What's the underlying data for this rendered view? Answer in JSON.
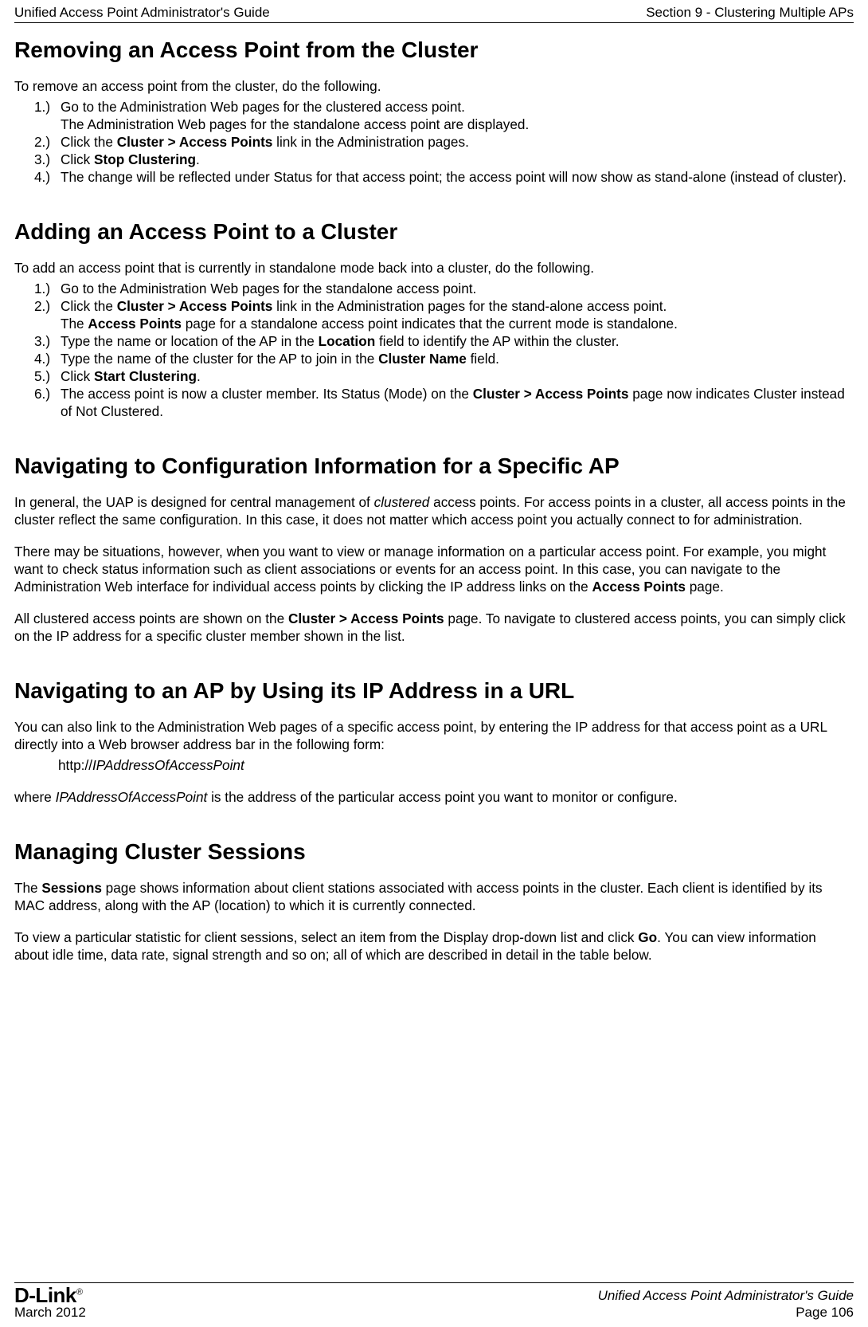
{
  "header": {
    "left": "Unified Access Point Administrator's Guide",
    "right": "Section 9 - Clustering Multiple APs"
  },
  "sections": {
    "removing": {
      "title": "Removing an Access Point from the Cluster",
      "intro": "To remove an access point from the cluster, do the following.",
      "steps": {
        "s1_num": "1.)",
        "s1_a": "Go to the Administration Web pages for the clustered access point.",
        "s1_b": "The Administration Web pages for the standalone access point are displayed.",
        "s2_num": "2.)",
        "s2_a": "Click the ",
        "s2_bold": "Cluster > Access Points",
        "s2_b": " link in the Administration pages.",
        "s3_num": "3.)",
        "s3_a": "Click ",
        "s3_bold": "Stop Clustering",
        "s3_b": ".",
        "s4_num": "4.)",
        "s4_a": "The change will be reflected under Status for that access point; the access point will now show as stand-alone (instead of cluster)."
      }
    },
    "adding": {
      "title": "Adding an Access Point to a Cluster",
      "intro": "To add an access point that is currently in standalone mode back into a cluster, do the following.",
      "steps": {
        "s1_num": "1.)",
        "s1_a": "Go to the Administration Web pages for the standalone access point.",
        "s2_num": "2.)",
        "s2_a": "Click the ",
        "s2_bold": "Cluster > Access Points",
        "s2_b": " link in the Administration pages for the stand-alone access point.",
        "s2_c1": "The ",
        "s2_c_bold": "Access Points",
        "s2_c2": " page for a standalone access point indicates that the current mode is standalone.",
        "s3_num": "3.)",
        "s3_a": "Type the name or location of the AP in the ",
        "s3_bold": "Location",
        "s3_b": " field to identify the AP within the cluster.",
        "s4_num": "4.)",
        "s4_a": "Type the name of the cluster for the AP to join in the ",
        "s4_bold": "Cluster Name",
        "s4_b": " field.",
        "s5_num": "5.)",
        "s5_a": "Click ",
        "s5_bold": "Start Clustering",
        "s5_b": ".",
        "s6_num": "6.)",
        "s6_a": "The access point is now a cluster member. Its Status (Mode) on the ",
        "s6_bold": "Cluster > Access Points",
        "s6_b": " page now indicates Cluster instead of Not Clustered."
      }
    },
    "navconfig": {
      "title": "Navigating to Configuration Information for a Specific AP",
      "p1_a": "In general, the UAP is designed for central management of ",
      "p1_it": "clustered",
      "p1_b": " access points. For access points in a cluster, all access points in the cluster reflect the same configuration. In this case, it does not matter which access point you actually connect to for administration.",
      "p2_a": "There may be situations, however, when you want to view or manage information on a particular access point. For example, you might want to check status information such as client associations or events for an access point. In this case, you can navigate to the Administration Web interface for individual access points by clicking the IP address links on the ",
      "p2_bold": "Access Points",
      "p2_b": " page.",
      "p3_a": "All clustered access points are shown on the ",
      "p3_bold": "Cluster > Access Points",
      "p3_b": " page. To navigate to clustered access points, you can simply click on the IP address for a specific cluster member shown in the list."
    },
    "navip": {
      "title": "Navigating to an AP by Using its IP Address in a URL",
      "p1": "You can also link to the Administration Web pages of a specific access point, by entering the IP address for that access point as a URL directly into a Web browser address bar in the following form:",
      "url_a": "http://",
      "url_it": "IPAddressOfAccessPoint",
      "p2_a": "where ",
      "p2_it": "IPAddressOfAccessPoint",
      "p2_b": " is the address of the particular access point you want to monitor or configure."
    },
    "sessions": {
      "title": "Managing Cluster Sessions",
      "p1_a": "The ",
      "p1_bold": "Sessions",
      "p1_b": " page shows information about client stations associated with access points in the cluster. Each client is identified by its MAC address, along with the AP (location) to which it is currently connected.",
      "p2_a": "To view a particular statistic for client sessions, select an item from the Display drop-down list and click ",
      "p2_bold": "Go",
      "p2_b": ". You can view information about idle time, data rate, signal strength and so on; all of which are described in detail in the table below."
    }
  },
  "footer": {
    "brand": "D-Link",
    "date": "March 2012",
    "right_title": "Unified Access Point Administrator's Guide",
    "page": "Page 106"
  }
}
